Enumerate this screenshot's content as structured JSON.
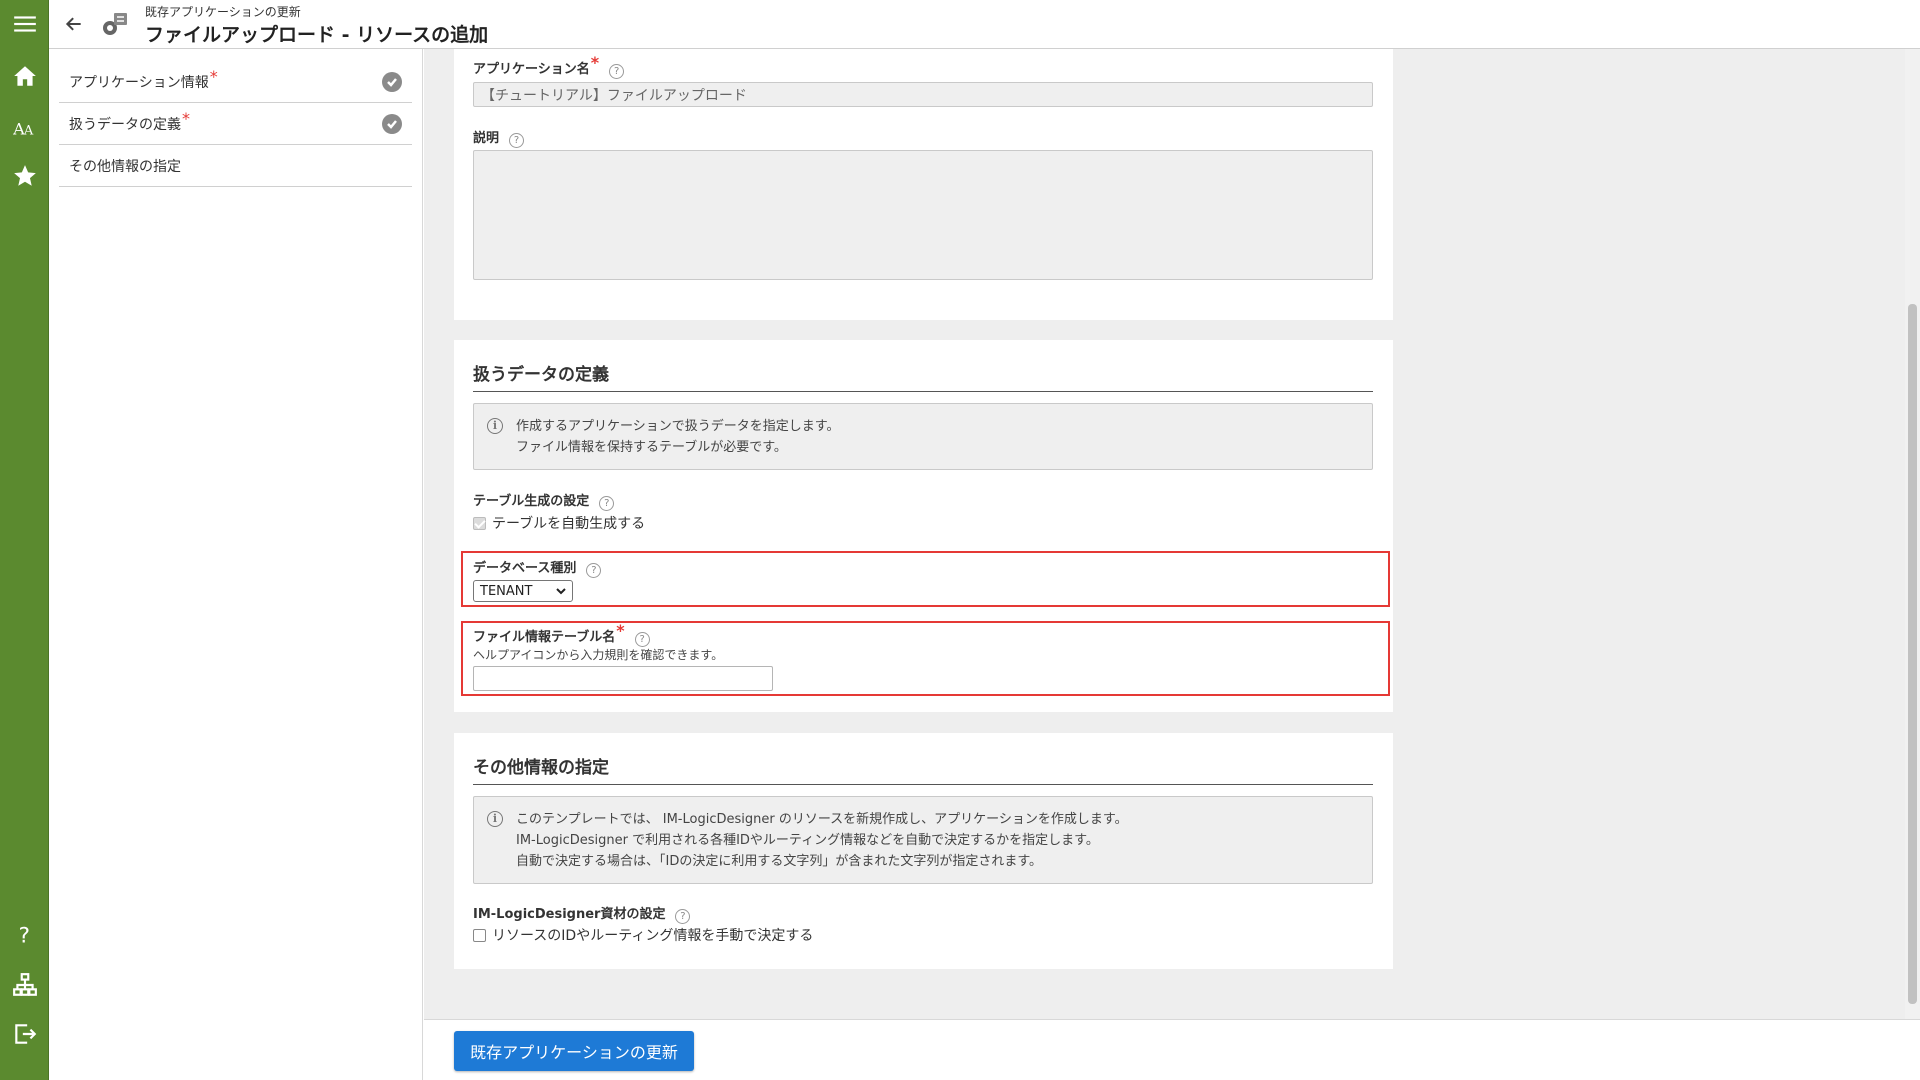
{
  "header": {
    "subtitle": "既存アプリケーションの更新",
    "title": "ファイルアップロード - リソースの追加"
  },
  "rail": {
    "icons": [
      "menu-icon",
      "home-icon",
      "font-icon",
      "star-icon",
      "help-icon",
      "sitemap-icon",
      "logout-icon"
    ]
  },
  "sidenav": {
    "items": [
      {
        "label": "アプリケーション情報",
        "required": "*",
        "completed": true
      },
      {
        "label": "扱うデータの定義",
        "required": "*",
        "completed": true
      },
      {
        "label": "その他情報の指定",
        "required": "",
        "completed": false
      }
    ]
  },
  "app_info": {
    "name_label": "アプリケーション名",
    "required_mark": "*",
    "name_value": "【チュートリアル】ファイルアップロード",
    "description_label": "説明",
    "description_value": ""
  },
  "data_def": {
    "section_title": "扱うデータの定義",
    "info_line1": "作成するアプリケーションで扱うデータを指定します。",
    "info_line2": "ファイル情報を保持するテーブルが必要です。",
    "table_gen_label": "テーブル生成の設定",
    "auto_gen_label": "テーブルを自動生成する",
    "db_type_label": "データベース種別",
    "db_type_value": "TENANT",
    "file_table_label": "ファイル情報テーブル名",
    "required_mark": "*",
    "file_table_hint": "ヘルプアイコンから入力規則を確認できます。",
    "file_table_value": ""
  },
  "other_info": {
    "section_title": "その他情報の指定",
    "info_line1": "このテンプレートでは、 IM-LogicDesigner のリソースを新規作成し、アプリケーションを作成します。",
    "info_line2": "IM-LogicDesigner で利用される各種IDやルーティング情報などを自動で決定するかを指定します。",
    "info_line3": "自動で決定する場合は、「IDの決定に利用する文字列」が含まれた文字列が指定されます。",
    "logic_label": "IM-LogicDesigner資材の設定",
    "manual_label": "リソースのIDやルーティング情報を手動で決定する"
  },
  "footer": {
    "submit_label": "既存アプリケーションの更新"
  },
  "colors": {
    "rail": "#5b8a2f",
    "primary": "#1e7ad6",
    "highlight": "#e53935",
    "required": "#e53935"
  }
}
